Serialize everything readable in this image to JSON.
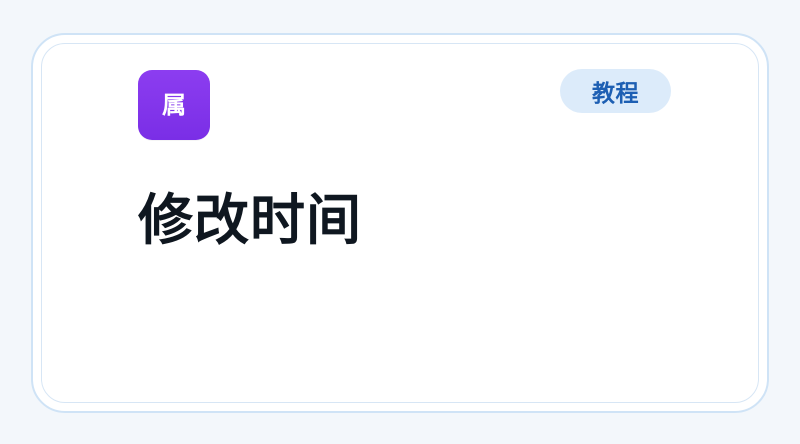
{
  "card": {
    "icon_text": "属",
    "badge": "教程",
    "title": "修改时间"
  }
}
